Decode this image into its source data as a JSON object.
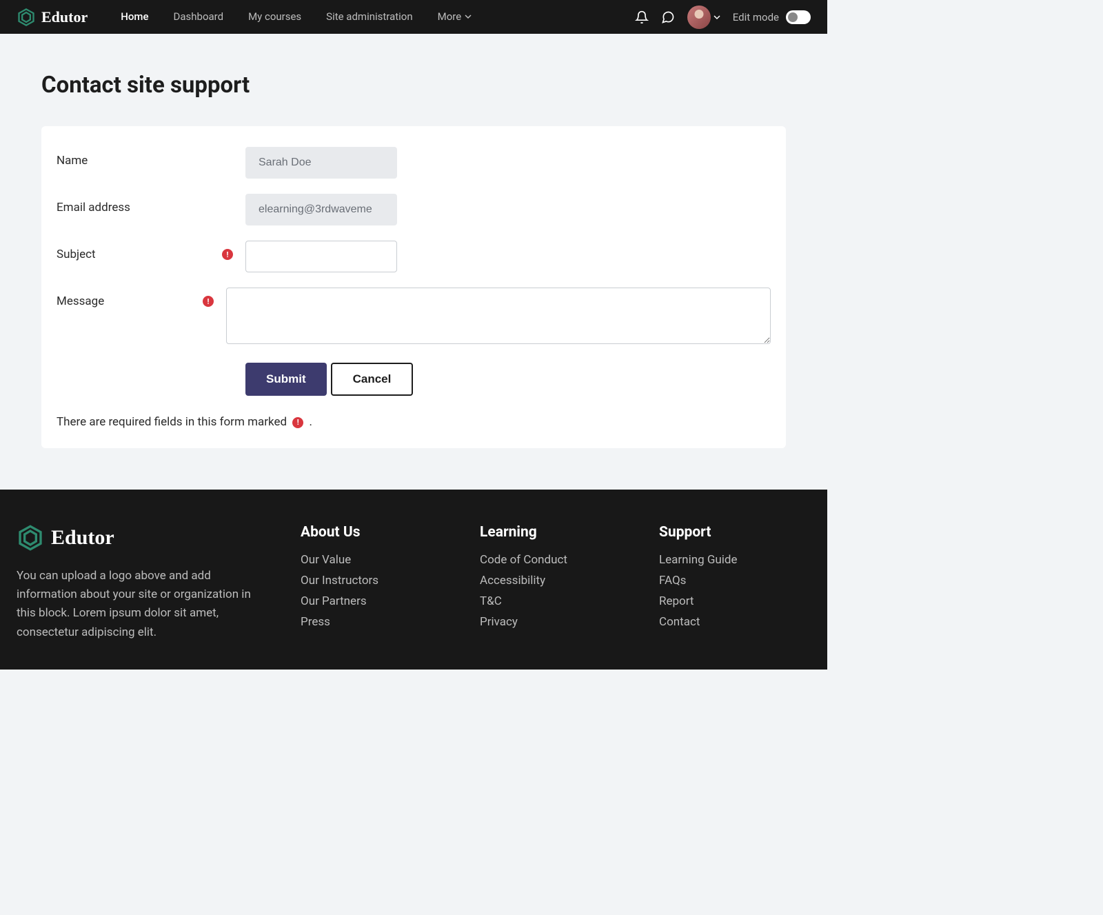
{
  "brand": {
    "name": "Edutor"
  },
  "nav": {
    "items": [
      {
        "label": "Home",
        "active": true
      },
      {
        "label": "Dashboard",
        "active": false
      },
      {
        "label": "My courses",
        "active": false
      },
      {
        "label": "Site administration",
        "active": false
      },
      {
        "label": "More",
        "active": false,
        "dropdown": true
      }
    ],
    "edit_mode_label": "Edit mode"
  },
  "page": {
    "title": "Contact site support"
  },
  "form": {
    "name_label": "Name",
    "name_value": "Sarah Doe",
    "email_label": "Email address",
    "email_value": "elearning@3rdwaveme",
    "subject_label": "Subject",
    "subject_value": "",
    "message_label": "Message",
    "message_value": "",
    "submit_label": "Submit",
    "cancel_label": "Cancel",
    "required_note_prefix": "There are required fields in this form marked",
    "required_note_suffix": "."
  },
  "footer": {
    "brand_name": "Edutor",
    "description": "You can upload a logo above and add information about your site or organization in this block. Lorem ipsum dolor sit amet, consectetur adipiscing elit.",
    "columns": [
      {
        "heading": "About Us",
        "links": [
          "Our Value",
          "Our Instructors",
          "Our Partners",
          "Press"
        ]
      },
      {
        "heading": "Learning",
        "links": [
          "Code of Conduct",
          "Accessibility",
          "T&C",
          "Privacy"
        ]
      },
      {
        "heading": "Support",
        "links": [
          "Learning Guide",
          "FAQs",
          "Report",
          "Contact"
        ]
      }
    ]
  }
}
